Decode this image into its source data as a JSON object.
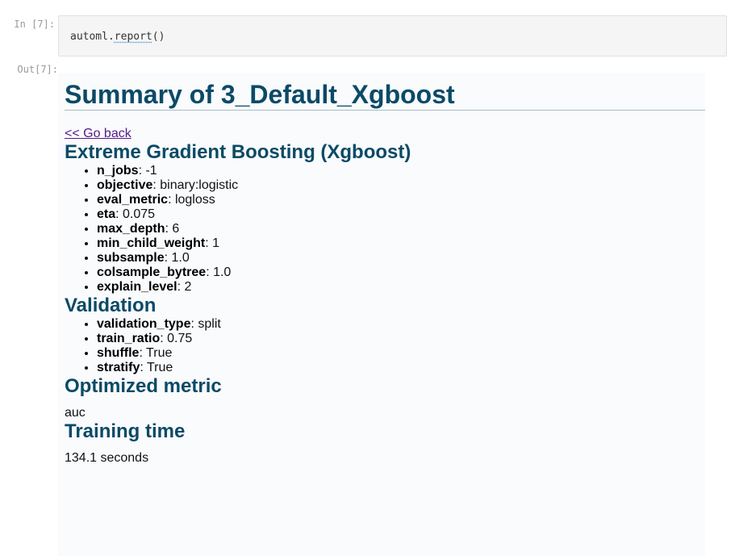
{
  "input": {
    "prompt": "In [7]:",
    "code_var": "automl",
    "code_dot": ".",
    "code_fn": "report",
    "code_args": "()"
  },
  "output": {
    "prompt": "Out[7]:",
    "title": "Summary of 3_Default_Xgboost",
    "back_link": "<< Go back",
    "model_heading": "Extreme Gradient Boosting (Xgboost)",
    "params": [
      {
        "key": "n_jobs",
        "value": ": -1"
      },
      {
        "key": "objective",
        "value": ": binary:logistic"
      },
      {
        "key": "eval_metric",
        "value": ": logloss"
      },
      {
        "key": "eta",
        "value": ": 0.075"
      },
      {
        "key": "max_depth",
        "value": ": 6"
      },
      {
        "key": "min_child_weight",
        "value": ": 1"
      },
      {
        "key": "subsample",
        "value": ": 1.0"
      },
      {
        "key": "colsample_bytree",
        "value": ": 1.0"
      },
      {
        "key": "explain_level",
        "value": ": 2"
      }
    ],
    "validation_heading": "Validation",
    "validation": [
      {
        "key": "validation_type",
        "value": ": split"
      },
      {
        "key": "train_ratio",
        "value": ": 0.75"
      },
      {
        "key": "shuffle",
        "value": ": True"
      },
      {
        "key": "stratify",
        "value": ": True"
      }
    ],
    "metric_heading": "Optimized metric",
    "metric_value": "auc",
    "time_heading": "Training time",
    "time_value": "134.1 seconds"
  }
}
